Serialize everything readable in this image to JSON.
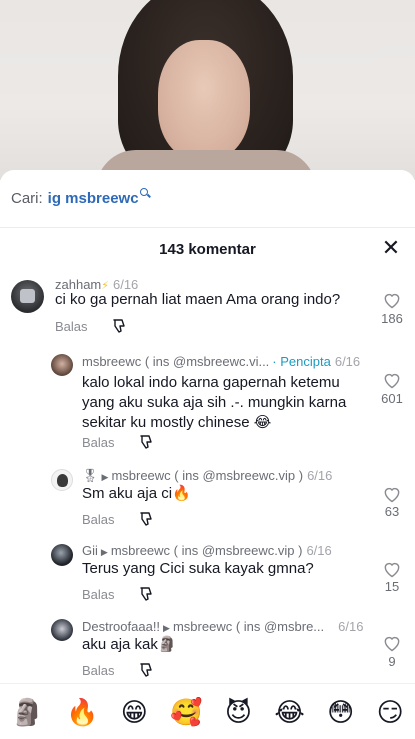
{
  "search": {
    "prefix": "Cari:",
    "query": "ig msbreewc"
  },
  "header": {
    "comment_count": "143 komentar"
  },
  "reply_label": "Balas",
  "comments": [
    {
      "user": "zahham",
      "badge": "⚡",
      "date": "6/16",
      "text": "ci ko ga pernah liat maen Ama orang indo?",
      "likes": "186"
    },
    {
      "user": "msbreewc ( ins @msbreewc.vi...",
      "creator": "· Pencipta",
      "date": "6/16",
      "text": "kalo lokal indo karna gapernah ketemu yang aku suka aja sih .-. mungkin karna sekitar ku mostly chinese 😂",
      "likes": "601"
    },
    {
      "user": "🎖",
      "reply_to": "msbreewc ( ins @msbreewc.vip )",
      "date": "6/16",
      "text": "Sm aku aja ci🔥",
      "likes": "63"
    },
    {
      "user": "Gii",
      "reply_to": "msbreewc ( ins @msbreewc.vip )",
      "date": "6/16",
      "text": "Terus yang Cici suka kayak gmna?",
      "likes": "15"
    },
    {
      "user": "Destroofaaa!!",
      "reply_to": "msbreewc ( ins @msbre...",
      "date": "6/16",
      "text": "aku aja kak🗿",
      "likes": "9"
    }
  ],
  "emojis": [
    "🗿",
    "🔥",
    "😁",
    "🥰",
    "😈",
    "😂",
    "😳",
    "😏"
  ]
}
